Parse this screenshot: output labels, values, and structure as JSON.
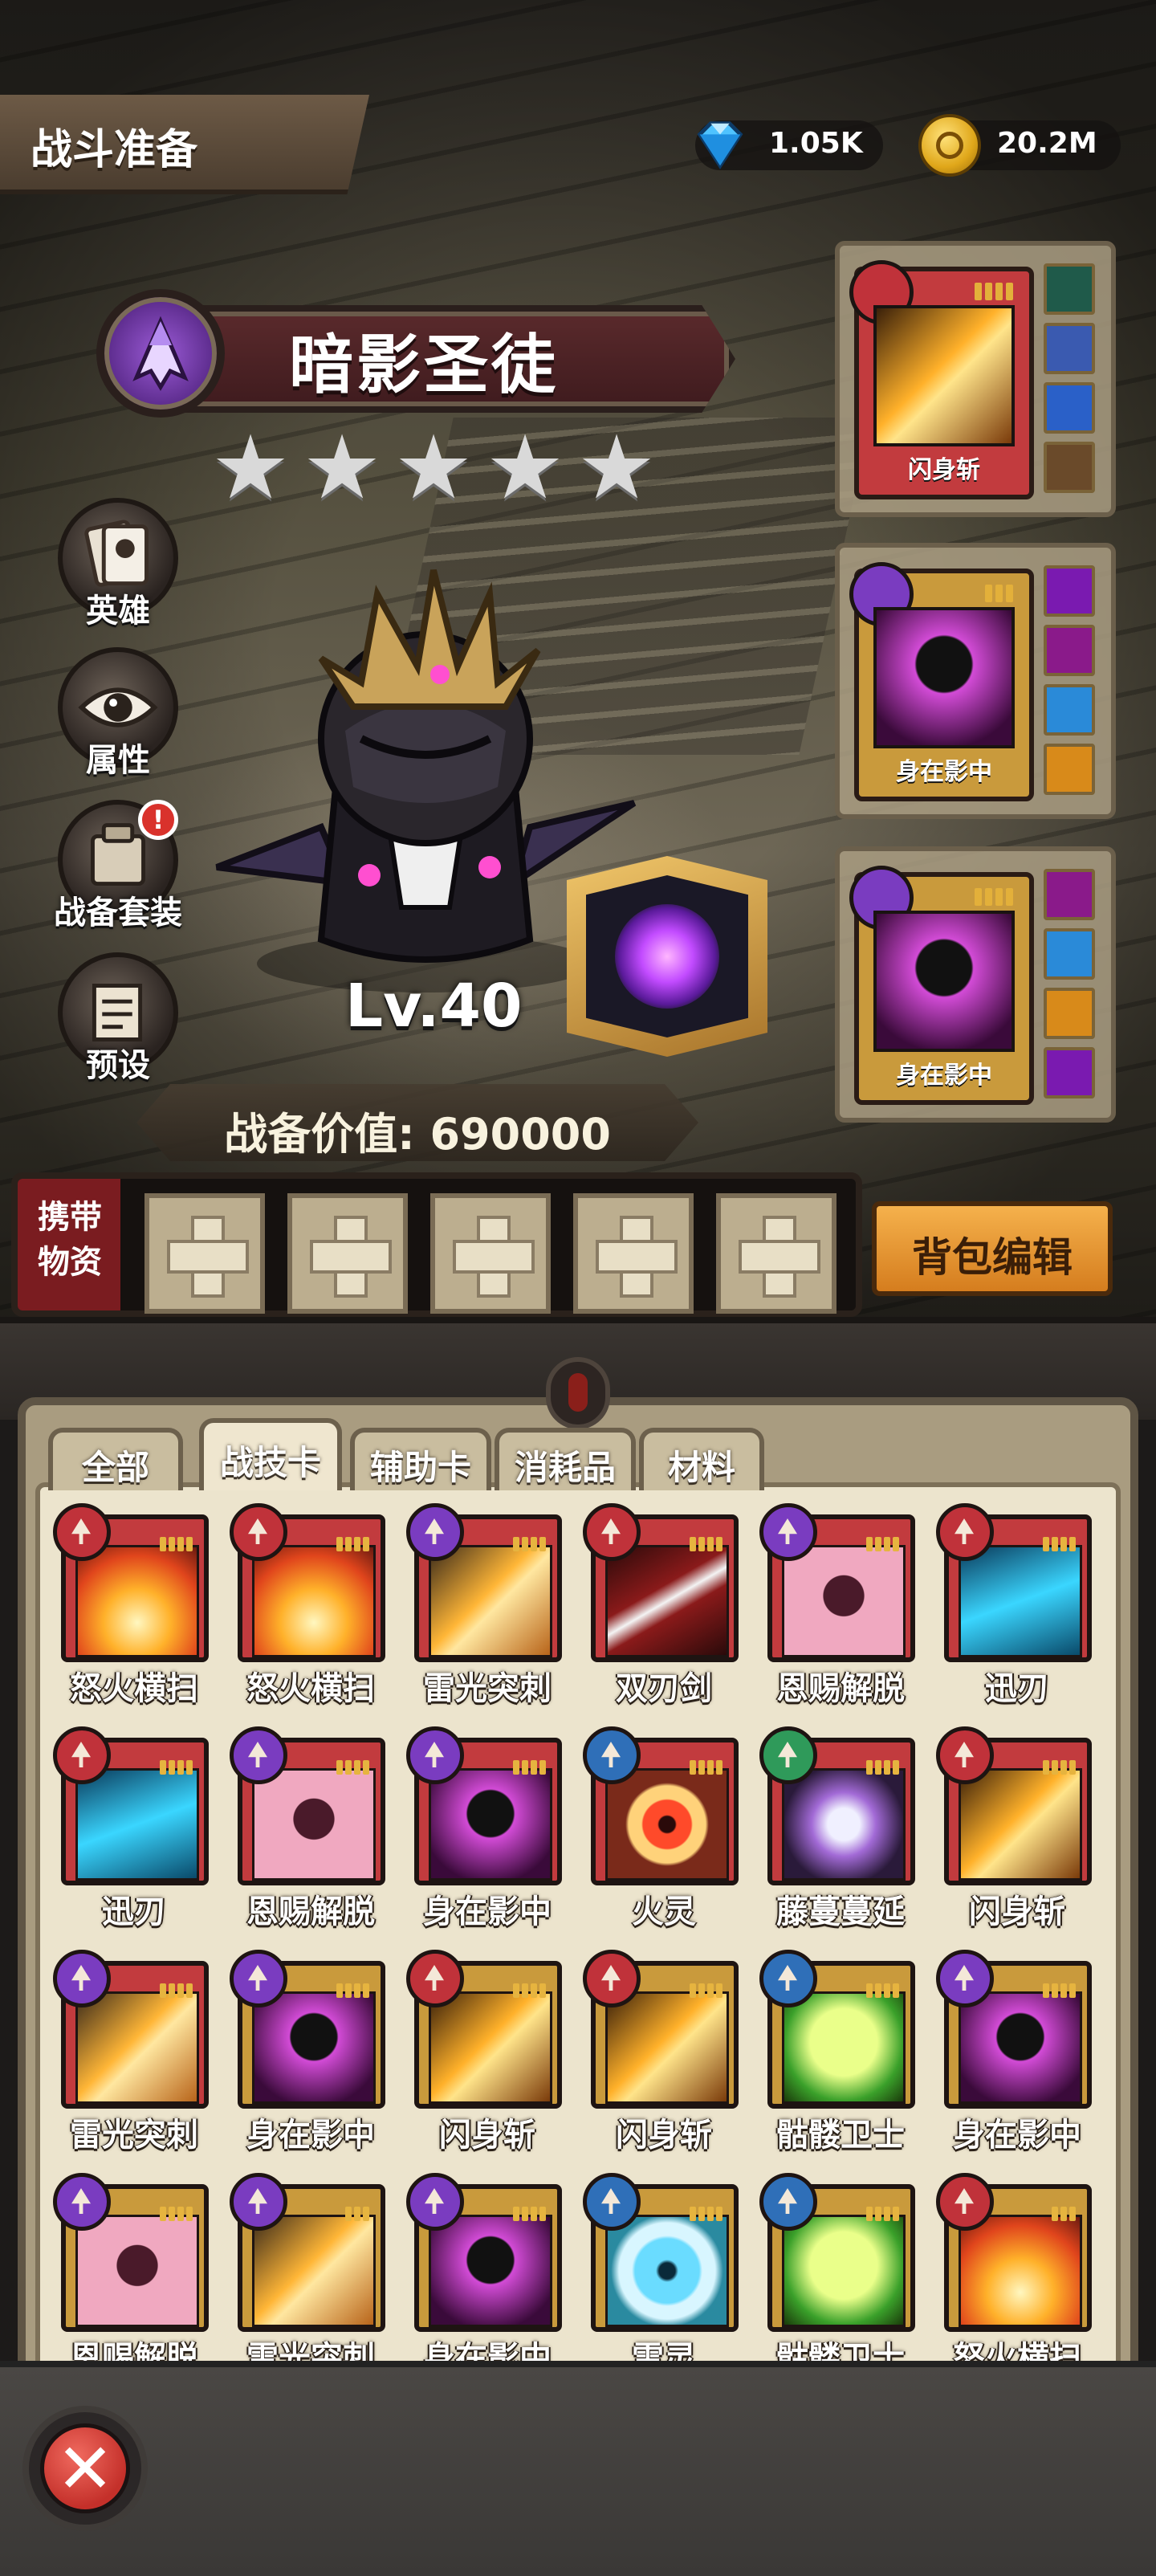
{
  "header": {
    "title": "战斗准备"
  },
  "currencies": [
    {
      "icon": "diamond-icon",
      "value": "1.05K"
    },
    {
      "icon": "gold-coin-icon",
      "value": "20.2M"
    }
  ],
  "hero": {
    "name": "暗影圣徒",
    "stars": 5,
    "level": "Lv.40",
    "power_label": "战备价值: 690000"
  },
  "side_menu": [
    {
      "icon": "hero-cards-icon",
      "label": "英雄"
    },
    {
      "icon": "eye-icon",
      "label": "属性"
    },
    {
      "icon": "equipment-set-icon",
      "label": "战备套装",
      "alert": "!"
    },
    {
      "icon": "preset-scroll-icon",
      "label": "预设"
    }
  ],
  "equipped": [
    {
      "name": "闪身斩",
      "tier": "red",
      "pips": 4,
      "minis": [
        "#1f5a4a",
        "#3a5ab0",
        "#2a60c8",
        "#6a4a2a"
      ]
    },
    {
      "name": "身在影中",
      "tier": "purple",
      "pips": 3,
      "minis": [
        "#7a1ab0",
        "#8a1a8a",
        "#2a8ad8",
        "#d88a1a"
      ]
    },
    {
      "name": "身在影中",
      "tier": "purple",
      "pips": 4,
      "minis": [
        "#8a1a8a",
        "#2a8ad8",
        "#d88a1a",
        "#7a1ab0"
      ]
    }
  ],
  "carry": {
    "label": "携带物资",
    "slots": 5,
    "edit_button": "背包编辑"
  },
  "tabs": [
    "全部",
    "战技卡",
    "辅助卡",
    "消耗品",
    "材料"
  ],
  "active_tab": "战技卡",
  "colors": {
    "red_tier": "#c0323a",
    "purple_tier": "#7a3cc0",
    "blue_tier": "#2f6fb8",
    "green_tier": "#2f9a5a",
    "gold_frame": "#c99a3c"
  },
  "cards": [
    {
      "name": "怒火横扫",
      "tier": "red",
      "frame": "red",
      "art": "fire",
      "pips": 4
    },
    {
      "name": "怒火横扫",
      "tier": "red",
      "frame": "red",
      "art": "fire",
      "pips": 4
    },
    {
      "name": "雷光突刺",
      "tier": "purple",
      "frame": "red",
      "art": "spear",
      "pips": 4
    },
    {
      "name": "双刃剑",
      "tier": "red",
      "frame": "red",
      "art": "blade",
      "pips": 4
    },
    {
      "name": "恩赐解脱",
      "tier": "purple",
      "frame": "red",
      "art": "skull",
      "pips": 4
    },
    {
      "name": "迅刃",
      "tier": "red",
      "frame": "red",
      "art": "ice",
      "pips": 4
    },
    {
      "name": "迅刃",
      "tier": "red",
      "frame": "red",
      "art": "ice",
      "pips": 4
    },
    {
      "name": "恩赐解脱",
      "tier": "purple",
      "frame": "red",
      "art": "skull",
      "pips": 4
    },
    {
      "name": "身在影中",
      "tier": "purple",
      "frame": "red",
      "art": "shadow",
      "pips": 4
    },
    {
      "name": "火灵",
      "tier": "blue",
      "frame": "red",
      "art": "eye",
      "pips": 4
    },
    {
      "name": "藤蔓蔓延",
      "tier": "green",
      "frame": "red",
      "art": "vine",
      "pips": 4
    },
    {
      "name": "闪身斩",
      "tier": "red",
      "frame": "red",
      "art": "axe",
      "pips": 4
    },
    {
      "name": "雷光突刺",
      "tier": "purple",
      "frame": "red",
      "art": "spear",
      "pips": 4
    },
    {
      "name": "身在影中",
      "tier": "purple",
      "frame": "gold",
      "art": "shadow",
      "pips": 4
    },
    {
      "name": "闪身斩",
      "tier": "red",
      "frame": "gold",
      "art": "axe",
      "pips": 4
    },
    {
      "name": "闪身斩",
      "tier": "red",
      "frame": "gold",
      "art": "axe",
      "pips": 4
    },
    {
      "name": "骷髅卫士",
      "tier": "blue",
      "frame": "gold",
      "art": "greenskull",
      "pips": 4
    },
    {
      "name": "身在影中",
      "tier": "purple",
      "frame": "gold",
      "art": "shadow",
      "pips": 4
    },
    {
      "name": "恩赐解脱",
      "tier": "purple",
      "frame": "gold",
      "art": "skull",
      "pips": 4
    },
    {
      "name": "雷光突刺",
      "tier": "purple",
      "frame": "gold",
      "art": "spear",
      "pips": 3
    },
    {
      "name": "身在影中",
      "tier": "purple",
      "frame": "gold",
      "art": "shadow",
      "pips": 4
    },
    {
      "name": "雷灵",
      "tier": "blue",
      "frame": "gold",
      "art": "iceeye",
      "pips": 4
    },
    {
      "name": "骷髅卫士",
      "tier": "blue",
      "frame": "gold",
      "art": "greenskull",
      "pips": 4
    },
    {
      "name": "怒火横扫",
      "tier": "red",
      "frame": "gold",
      "art": "fire",
      "pips": 3
    }
  ],
  "close_button": "✕"
}
